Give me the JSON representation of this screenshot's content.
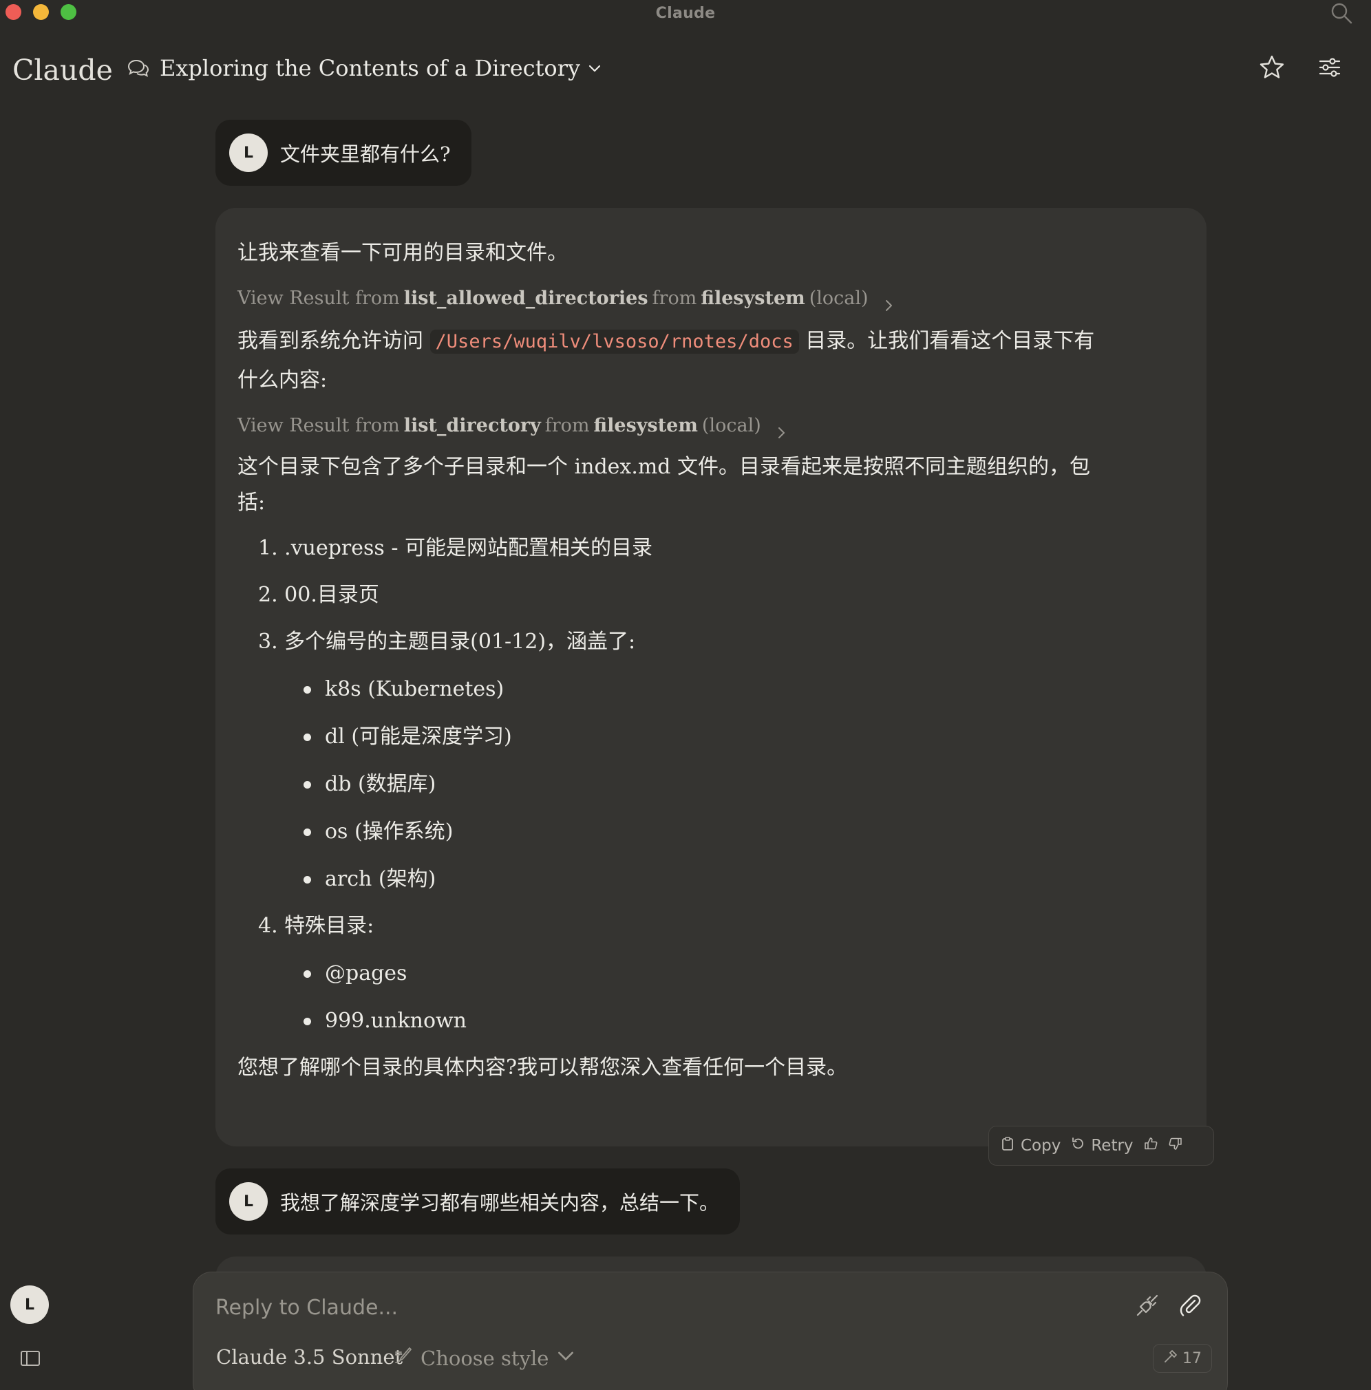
{
  "window": {
    "title": "Claude"
  },
  "header": {
    "brand": "Claude",
    "conversation_title": "Exploring the Contents of a Directory"
  },
  "messages": [
    {
      "role": "user",
      "avatar": "L",
      "text": "文件夹里都有什么?"
    },
    {
      "role": "assistant",
      "intro": "让我来查看一下可用的目录和文件。",
      "tool_calls": [
        {
          "prefix": "View Result from",
          "tool": "list_allowed_directories",
          "from": "from",
          "server": "filesystem",
          "scope": "(local)"
        },
        {
          "prefix": "View Result from",
          "tool": "list_directory",
          "from": "from",
          "server": "filesystem",
          "scope": "(local)"
        }
      ],
      "para2_before": "我看到系统允许访问",
      "path": "/Users/wuqilv/lvsoso/rnotes/docs",
      "para2_after": "目录。让我们看看这个目录下有",
      "para2_line2": "什么内容:",
      "para3_line1": "这个目录下包含了多个子目录和一个 index.md 文件。目录看起来是按照不同主题组织的，包",
      "para3_line2": "括:",
      "list": [
        {
          "label": "1. .vuepress - 可能是网站配置相关的目录"
        },
        {
          "label": "2. 00.目录页"
        },
        {
          "label": "3. 多个编号的主题目录(01-12)，涵盖了:"
        },
        {
          "label": "4. 特殊目录:"
        }
      ],
      "topics": [
        "k8s (Kubernetes)",
        "dl (可能是深度学习)",
        "db (数据库)",
        "os (操作系统)",
        "arch (架构)"
      ],
      "special": [
        "@pages",
        "999.unknown"
      ],
      "closing": "您想了解哪个目录的具体内容?我可以帮您深入查看任何一个目录。"
    },
    {
      "role": "user",
      "avatar": "L",
      "text": "我想了解深度学习都有哪些相关内容，总结一下。"
    }
  ],
  "actions": {
    "copy": "Copy",
    "retry": "Retry"
  },
  "composer": {
    "placeholder": "Reply to Claude...",
    "model": "Claude 3.5 Sonnet",
    "style": "Choose style",
    "tool_count": "17"
  },
  "sidebar": {
    "avatar": "L"
  },
  "colors": {
    "background": "#2b2a27",
    "assistant_bubble": "#353431",
    "user_bubble": "#1f1e1b",
    "code_text": "#ef8d7b"
  },
  "icons": [
    "search-icon",
    "chat-bubbles-icon",
    "chevron-down-icon",
    "star-icon",
    "sliders-icon",
    "chevron-right-icon",
    "clipboard-icon",
    "retry-icon",
    "thumbs-up-icon",
    "thumbs-down-icon",
    "sidebar-toggle-icon",
    "tools-plug-icon",
    "paperclip-icon",
    "brush-icon",
    "hammer-icon"
  ]
}
